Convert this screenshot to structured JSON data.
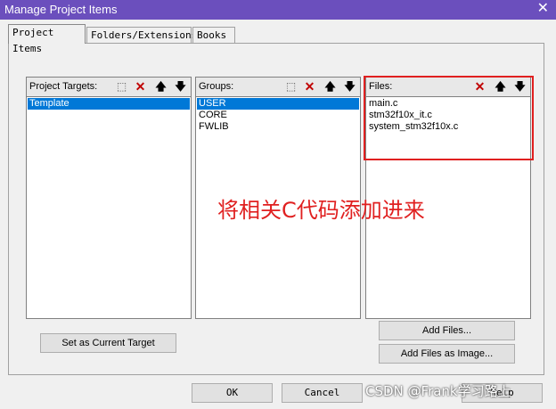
{
  "window": {
    "title": "Manage Project Items",
    "close_glyph": "✕"
  },
  "tabs": [
    {
      "label": "Project Items",
      "active": true
    },
    {
      "label": "Folders/Extensions",
      "active": false
    },
    {
      "label": "Books",
      "active": false
    }
  ],
  "targets": {
    "header": "Project Targets:",
    "items": [
      "Template"
    ],
    "selected": "Template"
  },
  "groups": {
    "header": "Groups:",
    "items": [
      "USER",
      "CORE",
      "FWLIB"
    ],
    "selected": "USER"
  },
  "files": {
    "header": "Files:",
    "items": [
      "main.c",
      "stm32f10x_it.c",
      "system_stm32f10x.c"
    ]
  },
  "toolbar_icons": {
    "new": "new-icon",
    "delete": "delete-icon",
    "up": "move-up-icon",
    "down": "move-down-icon"
  },
  "buttons": {
    "set_current": "Set as Current Target",
    "add_files": "Add Files...",
    "add_files_image": "Add Files as Image...",
    "ok": "OK",
    "cancel": "Cancel",
    "help": "Help"
  },
  "annotation": "将相关C代码添加进来",
  "watermark": "CSDN @Frank学习路上",
  "colors": {
    "titlebar": "#6b4fbd",
    "selection": "#0078d7",
    "annotation": "#e02020"
  }
}
